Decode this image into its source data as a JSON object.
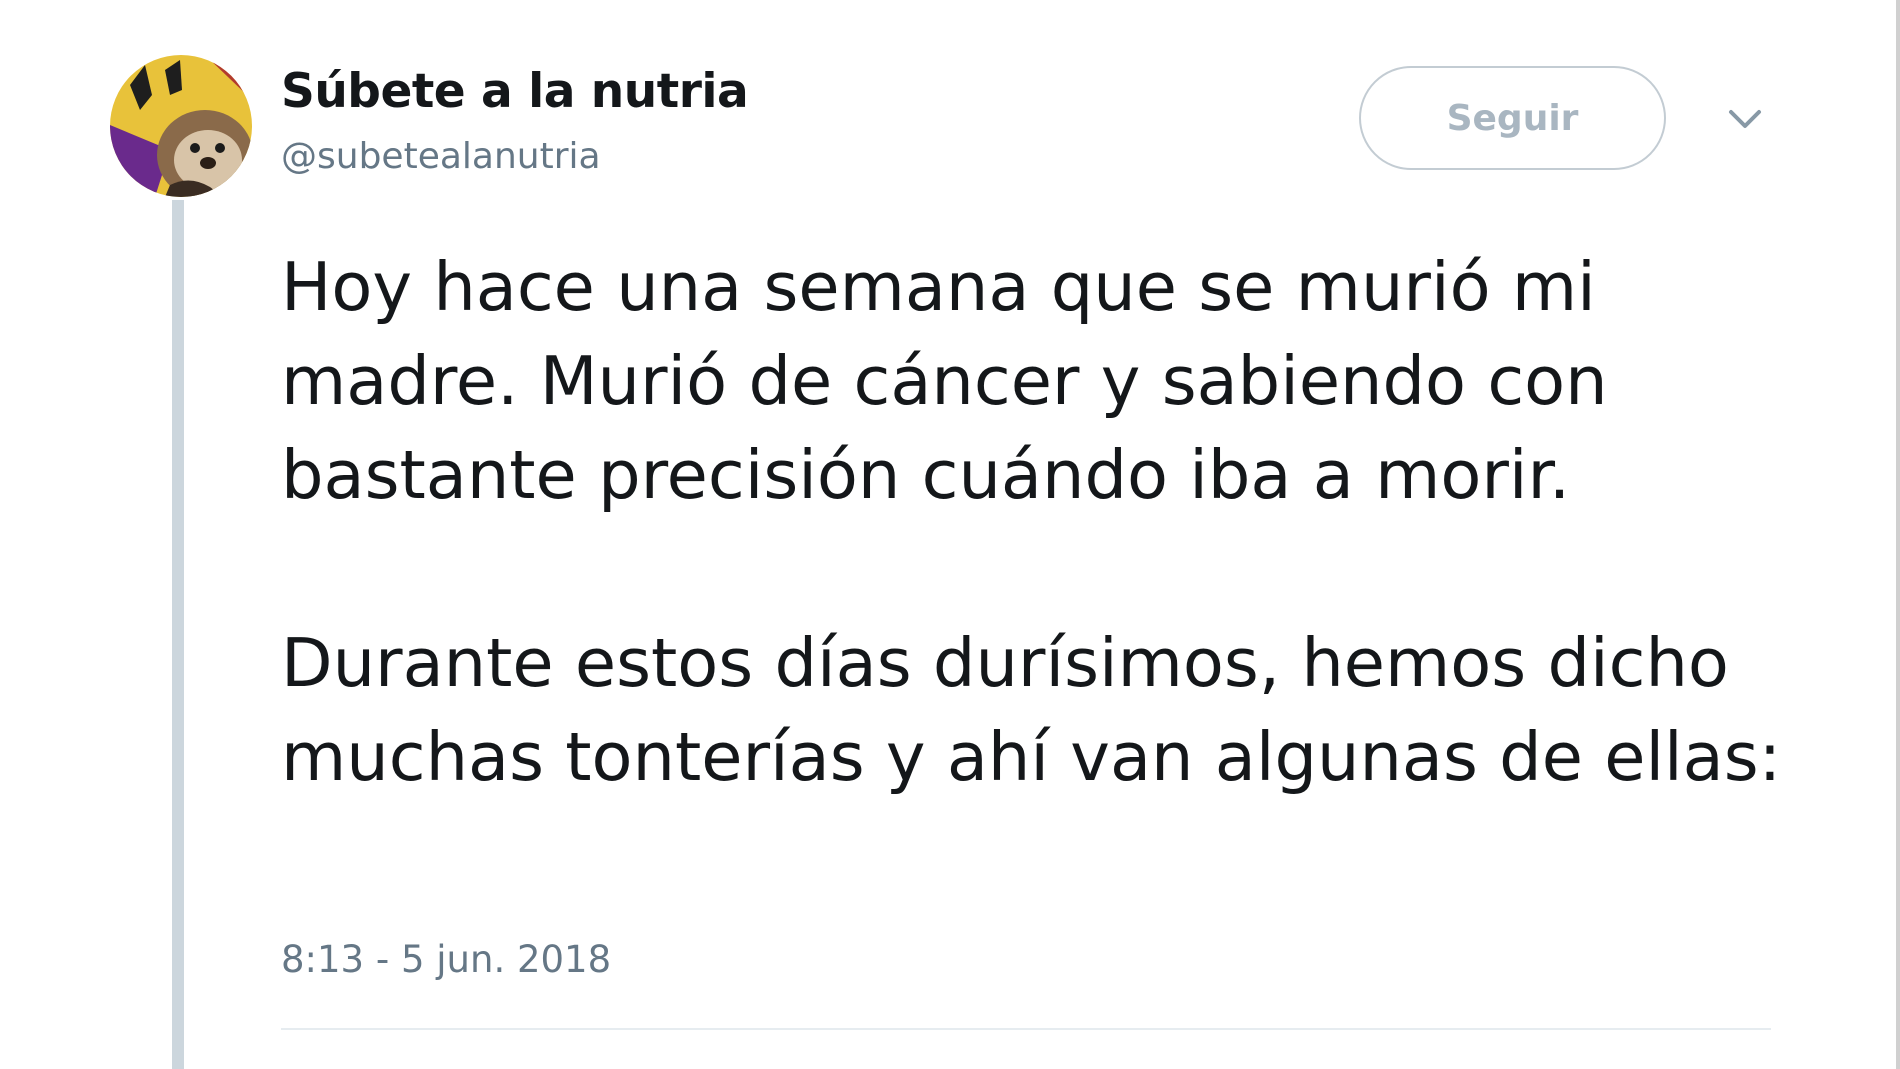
{
  "tweet": {
    "author": {
      "display_name": "Súbete a la nutria",
      "handle": "@subetealanutria",
      "avatar_icon": "otter-avatar"
    },
    "follow_button_label": "Seguir",
    "menu_icon": "chevron-down-icon",
    "paragraphs": [
      "Hoy hace una semana que se murió mi madre. Murió de cáncer y sabiendo con bastante precisión cuándo iba a morir.",
      "Durante estos días durísimos, hemos dicho muchas tonterías y ahí van algunas de ellas:"
    ],
    "timestamp": "8:13 - 5 jun. 2018"
  },
  "colors": {
    "text_primary": "#14171a",
    "text_secondary": "#657786",
    "button_border": "#c3ccd3",
    "button_text": "#a9b6c1",
    "thread_line": "#ccd6dd"
  }
}
